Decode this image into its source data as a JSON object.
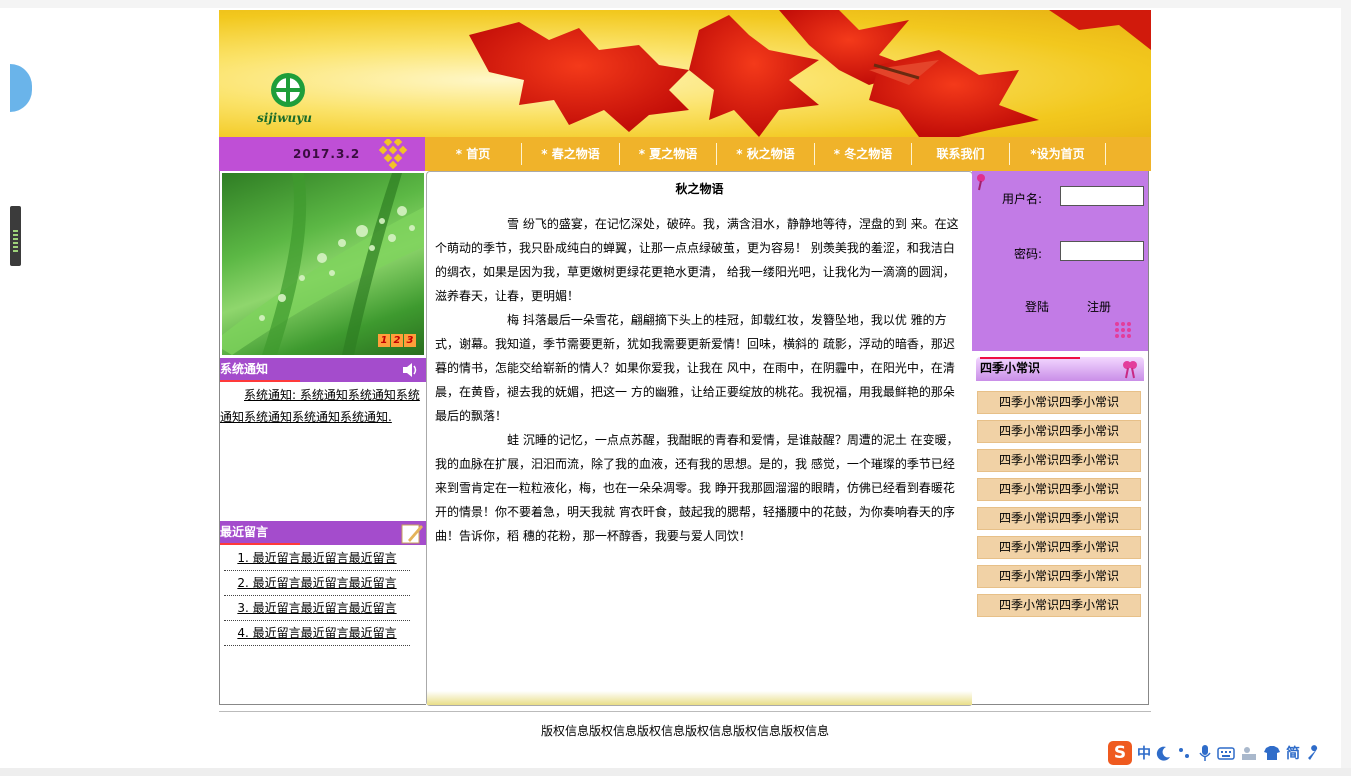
{
  "logo": {
    "text": "sijiwuyu"
  },
  "header": {
    "date": "2017.3.2"
  },
  "nav": {
    "items": [
      "* 首页",
      "* 春之物语",
      "* 夏之物语",
      "* 秋之物语",
      "* 冬之物语",
      "联系我们",
      "*设为首页"
    ]
  },
  "photo": {
    "pager": [
      "1",
      "2",
      "3"
    ]
  },
  "notice": {
    "title": "系统通知",
    "text": "系统通知: 系统通知系统通知系统通知系统通知系统通知系统通知."
  },
  "messages": {
    "title": "最近留言",
    "items": [
      "1. 最近留言最近留言最近留言",
      "2. 最近留言最近留言最近留言",
      "3. 最近留言最近留言最近留言",
      "4. 最近留言最近留言最近留言"
    ]
  },
  "article": {
    "title": "秋之物语",
    "paragraphs": [
      "雪 纷飞的盛宴，在记忆深处，破碎。我，满含泪水，静静地等待，涅盘的到 来。在这个萌动的季节，我只卧成纯白的蝉翼，让那一点点绿破茧，更为容易！ 别羡美我的羞涩，和我洁白的绸衣，如果是因为我，草更嫩树更绿花更艳水更清， 给我一缕阳光吧，让我化为一滴滴的圆润，滋养春天，让春，更明媚！",
      "梅 抖落最后一朵雪花，翩翩摘下头上的桂冠，卸载红妆，发簪坠地，我以优 雅的方式，谢幕。我知道，季节需要更新，犹如我需要更新爱情！回味，横斜的 疏影，浮动的暗香，那迟暮的情书，怎能交给崭新的情人？如果你爱我，让我在 风中，在雨中，在阴霾中，在阳光中，在清晨，在黄昏，褪去我的妩媚，把这一 方的幽雅，让给正要绽放的桃花。我祝福，用我最鲜艳的那朵最后的飘落！",
      "蛙 沉睡的记忆，一点点苏醒，我酣眠的青春和爱情，是谁敲醒？周遭的泥土 在变暖，我的血脉在扩展，汩汩而流，除了我的血液，还有我的思想。是的，我 感觉，一个璀璨的季节已经来到雪肯定在一粒粒液化，梅，也在一朵朵凋零。我 睁开我那圆溜溜的眼睛，仿佛已经看到春暖花开的情景！你不要着急，明天我就 宵衣旰食，鼓起我的腮帮，轻播腰中的花鼓，为你奏响春天的序曲！告诉你，稻 穗的花粉，那一杯醇香，我要与爱人同饮！"
    ]
  },
  "login": {
    "username_label": "用户名:",
    "password_label": "密码:",
    "username_value": "",
    "password_value": "",
    "login_button": "登陆",
    "register_button": "注册"
  },
  "tips": {
    "title": "四季小常识",
    "items": [
      "四季小常识四季小常识",
      "四季小常识四季小常识",
      "四季小常识四季小常识",
      "四季小常识四季小常识",
      "四季小常识四季小常识",
      "四季小常识四季小常识",
      "四季小常识四季小常识",
      "四季小常识四季小常识"
    ]
  },
  "footer": {
    "copyright": "版权信息版权信息版权信息版权信息版权信息版权信息"
  },
  "ime": {
    "logo": "S",
    "labels": [
      "中",
      "简"
    ]
  },
  "colors": {
    "nav_bar": "#f0b32a",
    "purple": "#bf4fd6",
    "login_bg": "#c27be6",
    "tip_bg": "#f1d2a6"
  }
}
